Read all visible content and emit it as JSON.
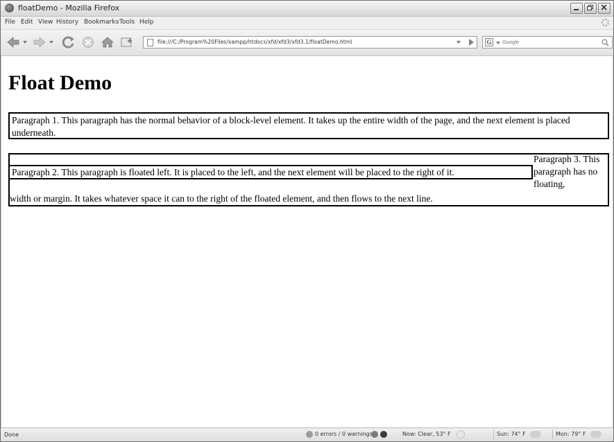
{
  "window": {
    "title": "floatDemo - Mozilla Firefox"
  },
  "menu": [
    "File",
    "Edit",
    "View",
    "History",
    "Bookmarks",
    "Tools",
    "Help"
  ],
  "navbar": {
    "url": "file:///C:/Program%20Files/xampp/htdocs/xfd/xfd3/xfd3.1/floatDemo.html",
    "search_placeholder": "Google"
  },
  "page": {
    "heading": "Float Demo",
    "paragraph1": "Paragraph 1. This paragraph has the normal behavior of a block-level element. It takes up the entire width of the page, and the next element is placed underneath.",
    "paragraph2": "Paragraph 2. This paragraph is floated left. It is placed to the left, and the next element will be placed to the right of it.",
    "paragraph3_part1": "Paragraph 3. This paragraph has no floating,",
    "paragraph3_part2": "width or margin. It takes whatever space it can to the right of the floated element, and then flows to the next line."
  },
  "status": {
    "left": "Done",
    "errors": "0 errors / 0 warnings",
    "weather_now": "Now: Clear, 53° F",
    "weather_sun": "Sun: 74° F",
    "weather_mon": "Mon: 79° F"
  }
}
